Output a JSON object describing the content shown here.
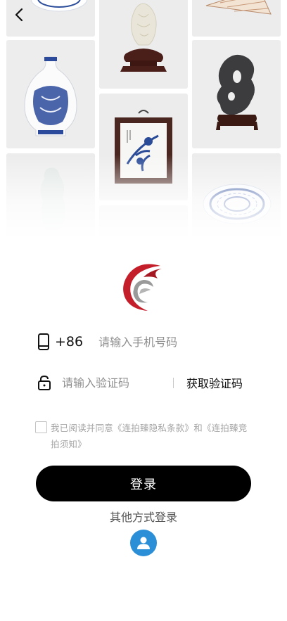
{
  "nav": {
    "back_icon": "chevron-left-icon"
  },
  "gallery": {
    "items": [
      "porcelain-plate-top",
      "jade-carving",
      "folding-fan",
      "blue-white-vase",
      "scholar-rock",
      "porcelain-plaque",
      "jade-figure",
      "small-object",
      "blue-white-plate"
    ]
  },
  "brand": {
    "logo_icon": "brand-logo-icon",
    "colors": {
      "red": "#c41e2a",
      "gray": "#9a9a9a"
    }
  },
  "login_form": {
    "phone": {
      "icon": "phone-icon",
      "country_code": "+86",
      "placeholder": "请输入手机号码",
      "value": ""
    },
    "code": {
      "icon": "lock-icon",
      "placeholder": "请输入验证码",
      "value": "",
      "get_code_label": "获取验证码"
    },
    "agreement": {
      "checked": false,
      "text": "我已阅读并同意《连拍臻隐私条款》和《连拍臻竞拍须知》"
    },
    "login_label": "登录",
    "other_methods_label": "其他方式登录",
    "alt_login_icon": "user-icon",
    "colors": {
      "button": "#000000",
      "alt_login": "#2b8fd8"
    }
  }
}
